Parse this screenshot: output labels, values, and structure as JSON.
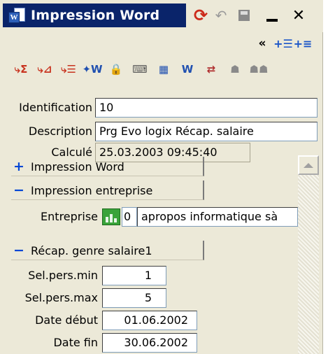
{
  "window": {
    "title": "Impression Word",
    "icons": {
      "app": "word-doc-icon",
      "refresh": "refresh-icon",
      "undo": "undo-icon",
      "save": "save-icon",
      "minimize": "minimize-icon",
      "close": "close-icon"
    },
    "glyphs": {
      "refresh": "⟳",
      "undo": "↶",
      "close": "✕",
      "app_letter": "W"
    }
  },
  "nav": {
    "glyphs": {
      "collapse": "«",
      "insert_row": "+☰",
      "insert_list": "+≡"
    }
  },
  "toolbar": {
    "tools": [
      {
        "name": "sum-fields-icon",
        "glyph": "⤷Σ",
        "color": "#c8321e"
      },
      {
        "name": "sort-fields-icon",
        "glyph": "⤷⊿",
        "color": "#c8321e"
      },
      {
        "name": "list-fields-icon",
        "glyph": "⤷☰",
        "color": "#c8321e"
      },
      {
        "name": "word-wizard-icon",
        "glyph": "✦W",
        "color": "#2050b0"
      },
      {
        "name": "lock-icon",
        "glyph": "🔒",
        "color": "#c89b1e"
      },
      {
        "name": "keyboard-icon",
        "glyph": "⌨",
        "color": "#5a5a5a"
      },
      {
        "name": "calendar-word-icon",
        "glyph": "▦",
        "color": "#2050b0"
      },
      {
        "name": "word-doc-icon",
        "glyph": "W",
        "color": "#2050b0"
      },
      {
        "name": "translate-icon",
        "glyph": "⇄",
        "color": "#b03030"
      },
      {
        "name": "group-add-icon",
        "glyph": "☗",
        "color": "#8a8a8a"
      },
      {
        "name": "group-icon",
        "glyph": "☗☗",
        "color": "#8a8a8a"
      }
    ]
  },
  "form": {
    "identification": {
      "label": "Identification",
      "value": "10"
    },
    "description": {
      "label": "Description",
      "value": "Prg Evo logix Récap. salaire"
    },
    "calcule": {
      "label": "Calculé",
      "value": "25.03.2003 09:45:40"
    }
  },
  "sections": [
    {
      "sign": "+",
      "label": "Impression Word"
    },
    {
      "sign": "−",
      "label": "Impression entreprise"
    },
    {
      "sign": "−",
      "label": "Récap. genre salaire1"
    }
  ],
  "entreprise": {
    "label": "Entreprise",
    "code": "0",
    "name": "apropos informatique sà"
  },
  "params": {
    "sel_min": {
      "label": "Sel.pers.min",
      "value": "1"
    },
    "sel_max": {
      "label": "Sel.pers.max",
      "value": "5"
    },
    "date_debut": {
      "label": "Date début",
      "value": "01.06.2002"
    },
    "date_fin": {
      "label": "Date fin",
      "value": "30.06.2002"
    }
  }
}
